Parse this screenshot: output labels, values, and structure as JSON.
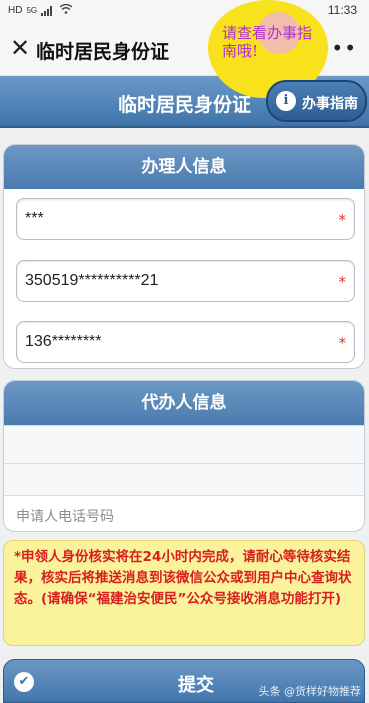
{
  "statusbar": {
    "network": "HD",
    "signal_label": "5G",
    "time": "11:33"
  },
  "header": {
    "close_icon": "close-icon",
    "title": "临时居民身份证",
    "more_icon": "more-icon"
  },
  "bubble": {
    "text": "请查看办事指南哦!"
  },
  "banner": {
    "title": "临时居民身份证",
    "guide_button": "办事指南"
  },
  "applicant": {
    "title": "办理人信息",
    "name": "***",
    "id_number": "350519**********21",
    "phone": "136********",
    "required_mark": "*"
  },
  "agent": {
    "title": "代办人信息",
    "phone_placeholder": "申请人电话号码"
  },
  "notice": {
    "text": "*申领人身份核实将在24小时内完成，请耐心等待核实结果，核实后将推送消息到该微信公众或到用户中心查询状态。(请确保“福建治安便民”公众号接收消息功能打开)"
  },
  "submit": {
    "label": "提交"
  },
  "watermark": {
    "text": "头条 @货样好物推荐"
  }
}
